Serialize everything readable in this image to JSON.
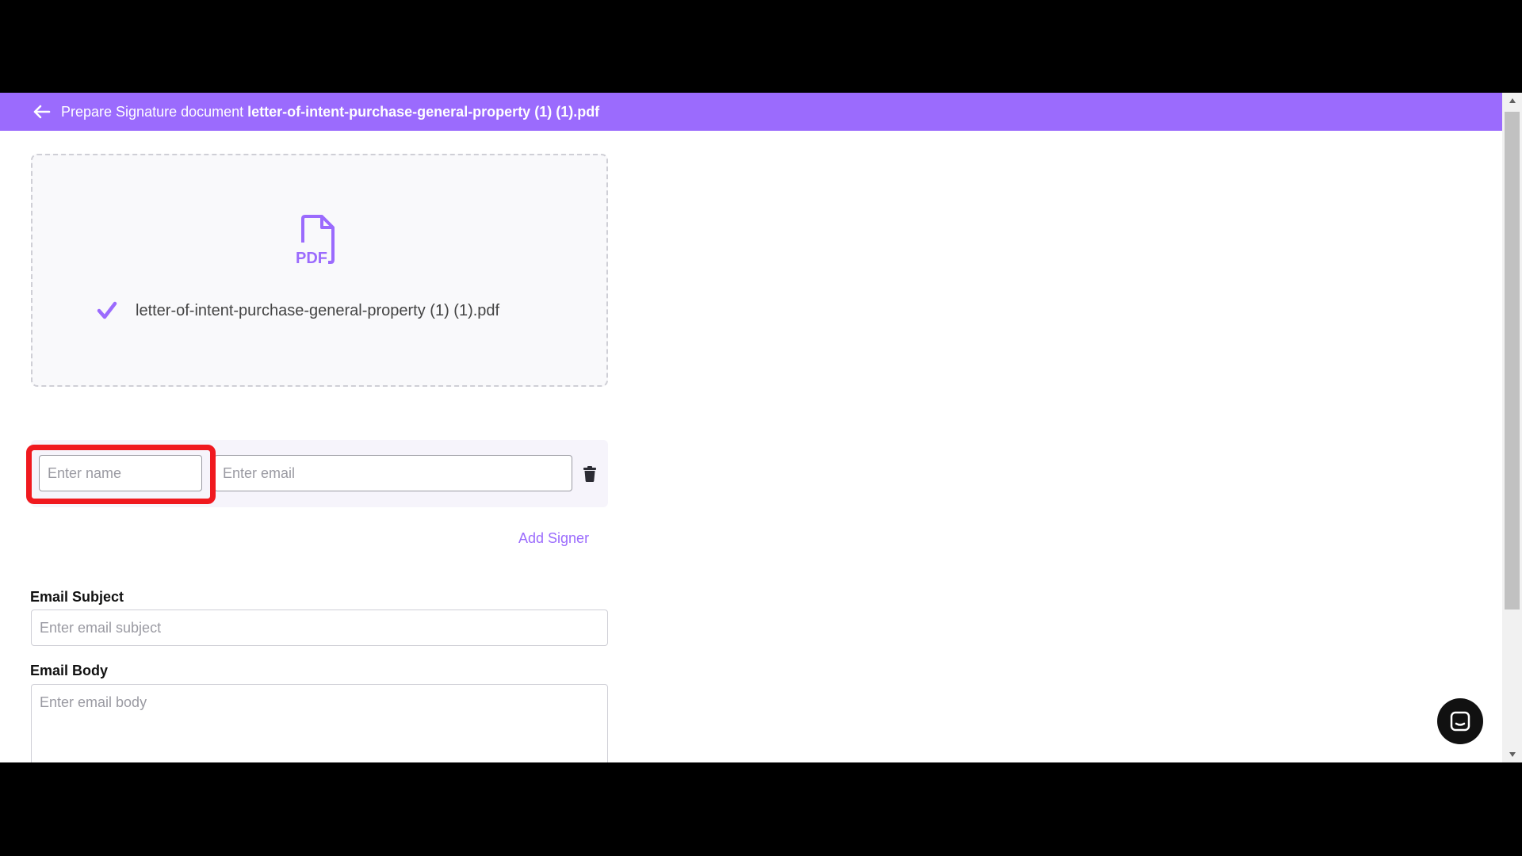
{
  "header": {
    "back_icon": "arrow-left-icon",
    "title_prefix": "Prepare Signature document ",
    "title_filename": "letter-of-intent-purchase-general-property (1) (1).pdf"
  },
  "upload": {
    "icon": "pdf-file-icon",
    "icon_text": "PDF",
    "status_icon": "checkmark-icon",
    "file_name": "letter-of-intent-purchase-general-property (1) (1).pdf"
  },
  "signer": {
    "name_placeholder": "Enter name",
    "name_value": "",
    "email_placeholder": "Enter email",
    "email_value": "",
    "delete_icon": "trash-icon"
  },
  "add_signer_label": "Add Signer",
  "email_subject": {
    "label": "Email Subject",
    "placeholder": "Enter email subject",
    "value": ""
  },
  "email_body": {
    "label": "Email Body",
    "placeholder": "Enter email body",
    "value": ""
  },
  "chat_widget": {
    "icon": "chat-bubble-icon"
  },
  "colors": {
    "accent": "#9b6bfd",
    "highlight": "#f0191f"
  }
}
